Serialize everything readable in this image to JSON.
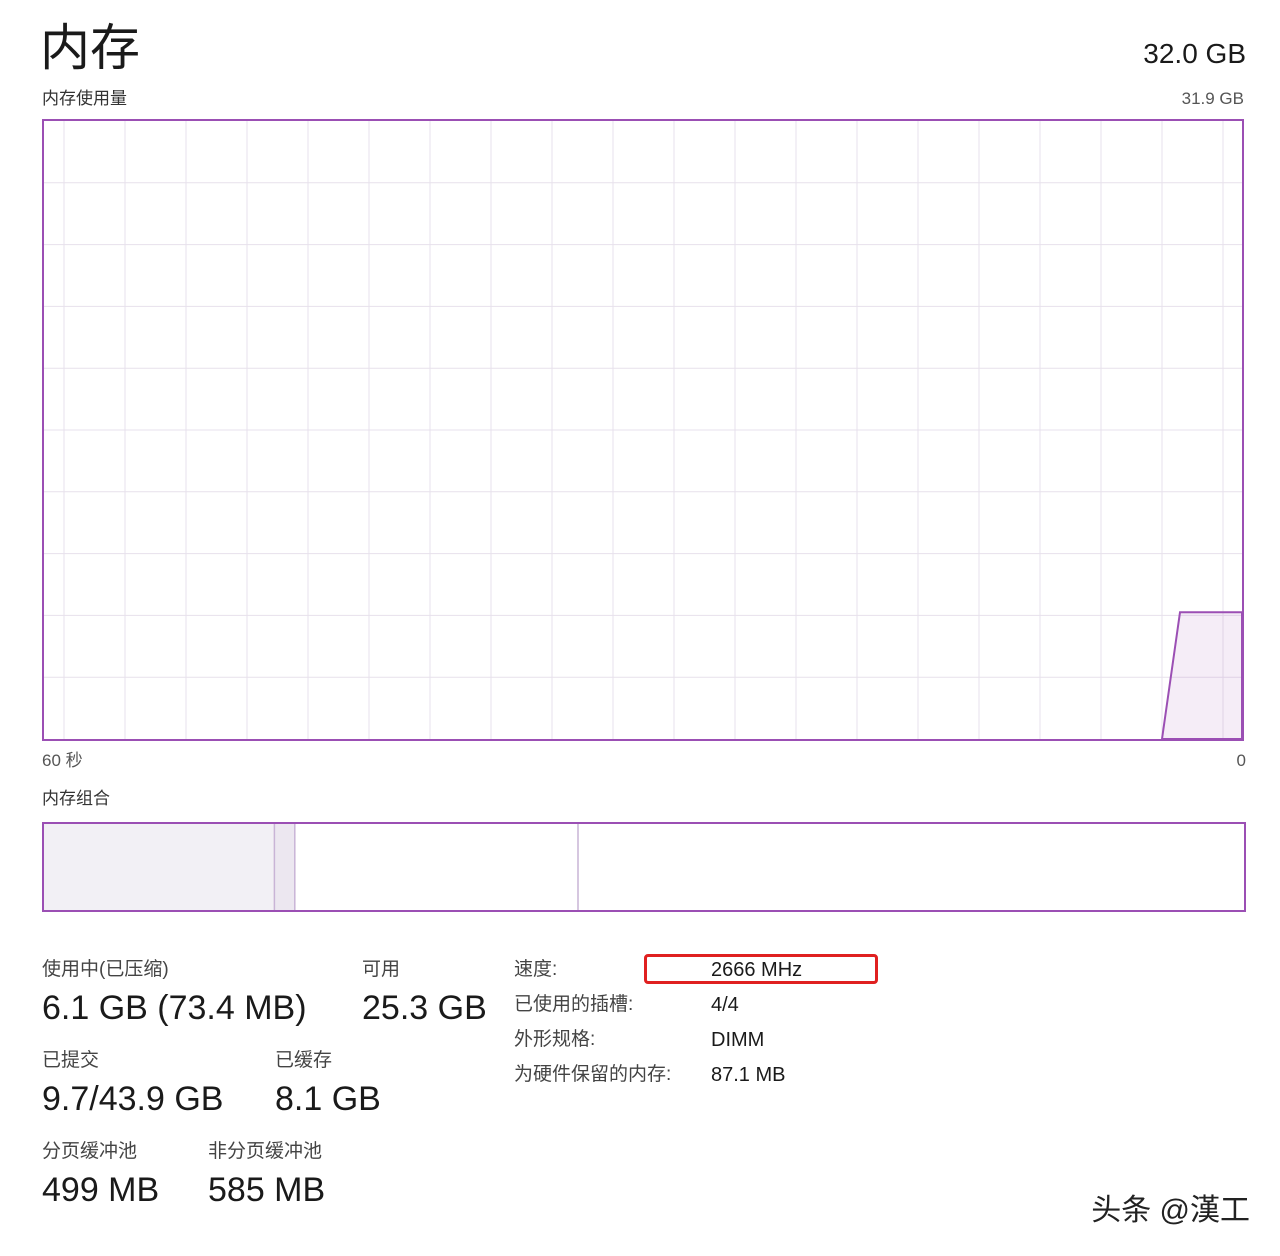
{
  "header": {
    "title": "内存",
    "total": "32.0 GB"
  },
  "usage_graph": {
    "label": "内存使用量",
    "max_label": "31.9 GB",
    "time_left": "60 秒",
    "time_right": "0",
    "line_color": "#9b4fb4",
    "usage_fraction": 0.205
  },
  "composition": {
    "label": "内存组合",
    "segments_fraction": {
      "in_use": 0.192,
      "modified": 0.017,
      "standby": 0.236,
      "free": 0.555
    }
  },
  "stats": {
    "in_use_label": "使用中(已压缩)",
    "in_use_value": "6.1 GB (73.4 MB)",
    "available_label": "可用",
    "available_value": "25.3 GB",
    "committed_label": "已提交",
    "committed_value": "9.7/43.9 GB",
    "cached_label": "已缓存",
    "cached_value": "8.1 GB",
    "paged_label": "分页缓冲池",
    "paged_value": "499 MB",
    "nonpaged_label": "非分页缓冲池",
    "nonpaged_value": "585 MB"
  },
  "details": {
    "speed_label": "速度:",
    "speed_value": "2666 MHz",
    "slots_label": "已使用的插槽:",
    "slots_value": "4/4",
    "form_label": "外形规格:",
    "form_value": "DIMM",
    "reserved_label": "为硬件保留的内存:",
    "reserved_value": "87.1 MB"
  },
  "watermark": "头条 @漢工"
}
